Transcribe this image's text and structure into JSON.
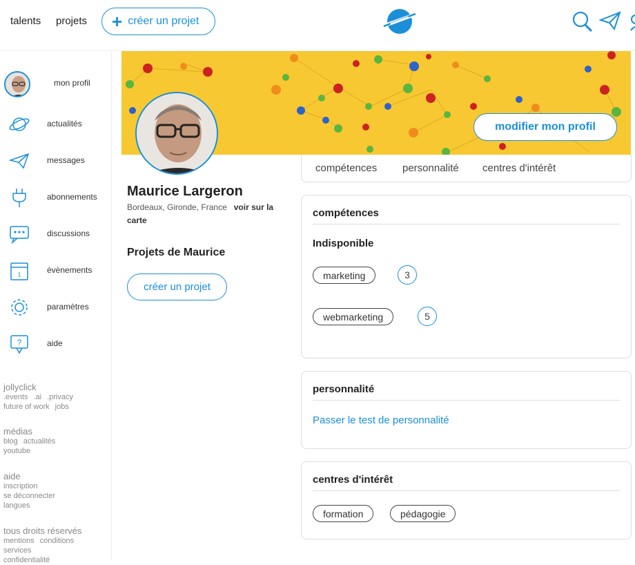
{
  "topbar": {
    "nav": [
      "talents",
      "projets"
    ],
    "create_project": "créer un projet",
    "icons": [
      "search-icon",
      "send-icon",
      "user-icon"
    ]
  },
  "sidebar": {
    "items": [
      {
        "label": "mon profil",
        "icon": "avatar"
      },
      {
        "label": "actualités",
        "icon": "planet-icon"
      },
      {
        "label": "messages",
        "icon": "paper-plane-icon"
      },
      {
        "label": "abonnements",
        "icon": "plug-icon"
      },
      {
        "label": "discussions",
        "icon": "chat-icon"
      },
      {
        "label": "évènements",
        "icon": "calendar-icon"
      },
      {
        "label": "paramètres",
        "icon": "gear-icon"
      },
      {
        "label": "aide",
        "icon": "help-icon"
      }
    ],
    "footer": [
      {
        "heading": "jollyclick",
        "links": [
          ".events",
          ".ai",
          ".privacy",
          "future of work",
          "jobs"
        ]
      },
      {
        "heading": "médias",
        "links": [
          "blog",
          "actualités",
          "youtube"
        ]
      },
      {
        "heading": "aide",
        "links": [
          "inscription",
          "se déconnecter",
          "langues"
        ]
      },
      {
        "heading": "tous droits réservés",
        "links": [
          "mentions",
          "conditions",
          "services",
          "confidentialité"
        ]
      }
    ]
  },
  "profile": {
    "name": "Maurice Largeron",
    "location": "Bordeaux, Gironde, France",
    "map_link": "voir sur la carte",
    "edit_button": "modifier mon profil",
    "projects_title": "Projets de Maurice",
    "create_project": "créer un projet"
  },
  "tabs": [
    "compétences",
    "personnalité",
    "centres d'intérêt"
  ],
  "skills": {
    "title": "compétences",
    "status": "Indisponible",
    "items": [
      {
        "label": "marketing",
        "count": "3"
      },
      {
        "label": "webmarketing",
        "count": "5"
      }
    ]
  },
  "personality": {
    "title": "personnalité",
    "link": "Passer le test de personnalité"
  },
  "interests": {
    "title": "centres d'intérêt",
    "items": [
      "formation",
      "pédagogie"
    ]
  },
  "colors": {
    "accent": "#1a8fd8",
    "banner": "#f7c832"
  }
}
